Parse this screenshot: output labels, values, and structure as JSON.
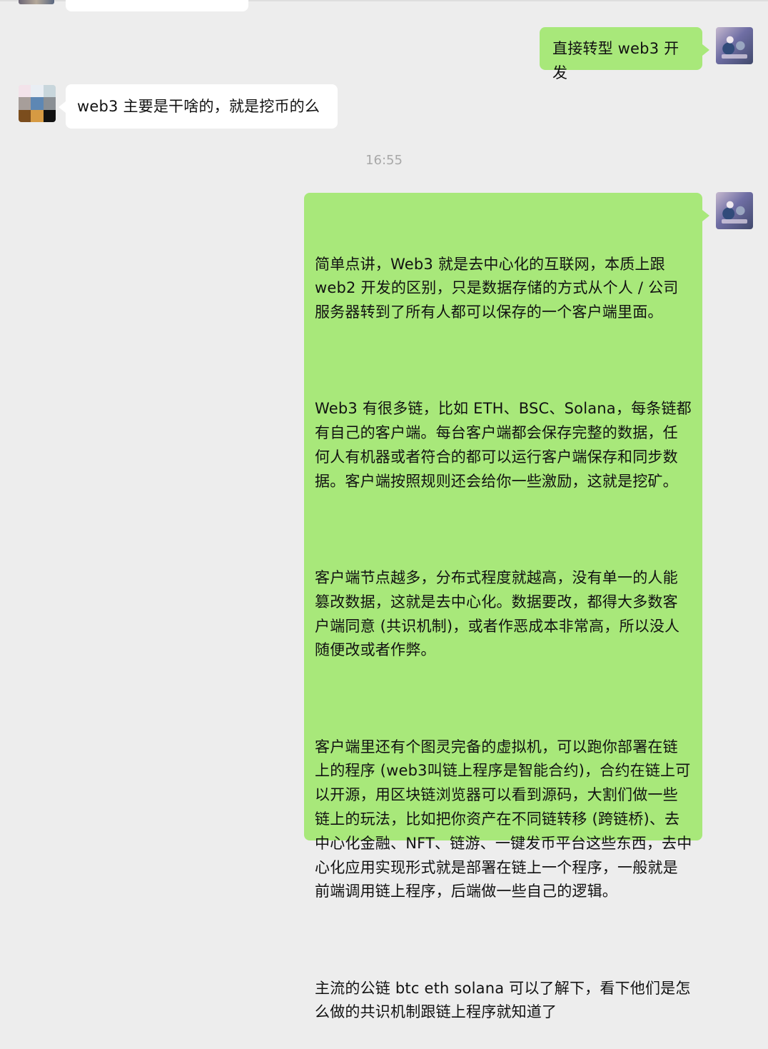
{
  "chat": {
    "messages": [
      {
        "id": "m1",
        "sender": "self",
        "text": "直接转型 web3 开发"
      },
      {
        "id": "m2",
        "sender": "other",
        "text": "web3 主要是干啥的，就是挖币的么"
      },
      {
        "id": "m3",
        "sender": "self",
        "paragraphs": [
          "简单点讲，Web3 就是去中心化的互联网，本质上跟 web2 开发的区别，只是数据存储的方式从个人 / 公司服务器转到了所有人都可以保存的一个客户端里面。",
          "Web3 有很多链，比如 ETH、BSC、Solana，每条链都有自己的客户端。每台客户端都会保存完整的数据，任何人有机器或者符合的都可以运行客户端保存和同步数据。客户端按照规则还会给你一些激励，这就是挖矿。",
          "客户端节点越多，分布式程度就越高，没有单一的人能篡改数据，这就是去中心化。数据要改，都得大多数客户端同意 (共识机制)，或者作恶成本非常高，所以没人随便改或者作弊。",
          "客户端里还有个图灵完备的虚拟机，可以跑你部署在链上的程序 (web3叫链上程序是智能合约)，合约在链上可以开源，用区块链浏览器可以看到源码，大割们做一些链上的玩法，比如把你资产在不同链转移 (跨链桥)、去中心化金融、NFT、链游、一键发币平台这些东西，去中心化应用实现形式就是部署在链上一个程序，一般就是前端调用链上程序，后端做一些自己的逻辑。",
          "主流的公链 btc eth solana 可以了解下，看下他们是怎么做的共识机制跟链上程序就知道了"
        ]
      }
    ],
    "time_divider": "16:55"
  },
  "colors": {
    "background": "#ededed",
    "self_bubble": "#a8e87a",
    "other_bubble": "#ffffff",
    "time_text": "#a8a8a8",
    "text": "#111111"
  },
  "avatar_other_pixels": [
    "#f3e3ea",
    "#e9eef4",
    "#c8d6dc",
    "#a79e9a",
    "#5d87b4",
    "#8a8f94",
    "#7b4d1d",
    "#d69a43",
    "#111111"
  ]
}
